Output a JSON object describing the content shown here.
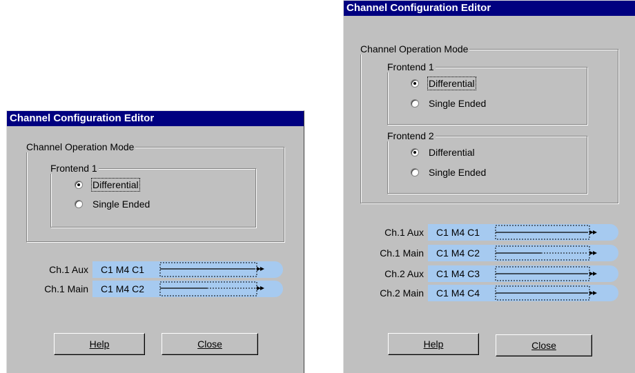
{
  "left_dialog": {
    "title": "Channel Configuration Editor",
    "mode_group": "Channel Operation Mode",
    "frontend1": {
      "label": "Frontend 1",
      "options": [
        {
          "label": "Differential",
          "selected": true
        },
        {
          "label": "Single Ended",
          "selected": false
        }
      ]
    },
    "channels": [
      {
        "label": "Ch.1 Aux",
        "code": "C1 M4 C1",
        "line": "solid"
      },
      {
        "label": "Ch.1 Main",
        "code": "C1 M4 C2",
        "line": "partial-dotted"
      }
    ],
    "help_label": "Help",
    "close_label": "Close"
  },
  "right_dialog": {
    "title": "Channel Configuration Editor",
    "mode_group": "Channel Operation Mode",
    "frontend1": {
      "label": "Frontend 1",
      "options": [
        {
          "label": "Differential",
          "selected": true
        },
        {
          "label": "Single Ended",
          "selected": false
        }
      ]
    },
    "frontend2": {
      "label": "Frontend 2",
      "options": [
        {
          "label": "Differential",
          "selected": true
        },
        {
          "label": "Single Ended",
          "selected": false
        }
      ]
    },
    "channels": [
      {
        "label": "Ch.1 Aux",
        "code": "C1 M4 C1",
        "line": "solid"
      },
      {
        "label": "Ch.1 Main",
        "code": "C1 M4 C2",
        "line": "partial-dotted"
      },
      {
        "label": "Ch.2 Aux",
        "code": "C1 M4 C3",
        "line": "solid"
      },
      {
        "label": "Ch.2 Main",
        "code": "C1 M4 C4",
        "line": "solid"
      }
    ],
    "help_label": "Help",
    "close_label": "Close"
  },
  "colors": {
    "dialog_bg": "#c0c0c0",
    "titlebar": "#000080",
    "channel_pill": "#a6caf0"
  }
}
